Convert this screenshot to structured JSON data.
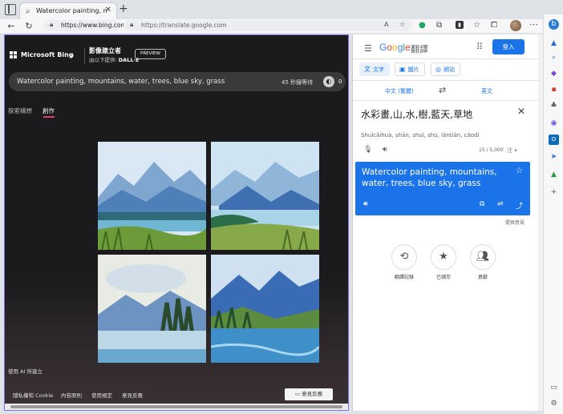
{
  "browser": {
    "tab_title": "Watercolor painting, mountains",
    "tab_close": "✕",
    "new_tab": "+",
    "url_bing": "https://www.bing.com",
    "url_translate": "https://translate.google.com"
  },
  "bing": {
    "brand": "Microsoft Bing",
    "creator_title": "影像建立者",
    "creator_sub_prefix": "由以下提供: ",
    "creator_sub_brand": "DALL·E",
    "preview_badge": "PREVIEW",
    "prompt": "Watercolor painting, mountains, water, trees, blue sky, grass",
    "wait_text": "45 秒鐘等待",
    "boost_count": "0",
    "tabs": [
      "探索構想",
      "創作"
    ],
    "ai_note": "使用 AI 所建立",
    "footer_links": [
      "隱私權和 Cookie",
      "內容原則",
      "使用規定",
      "意見反應"
    ],
    "feedback_button": "意見反應"
  },
  "translate": {
    "logo": "Google",
    "product": "翻譯",
    "signin": "登入",
    "modes": [
      "文字",
      "圖片",
      "網站"
    ],
    "source_lang": "中文 (繁體)",
    "target_lang": "英文",
    "source_text": "水彩畫,山,水,樹,藍天,草地",
    "romanization": "Shuǐcǎihuà, shān, shuǐ, shù, lántiān, cǎodì",
    "char_count": "15 / 5,000",
    "tool_label": "注",
    "result_text": "Watercolor painting, mountains, water, trees, blue sky, grass",
    "feedback": "提供意見",
    "bottom_actions": [
      "翻譯記錄",
      "已儲存",
      "貢獻"
    ]
  }
}
